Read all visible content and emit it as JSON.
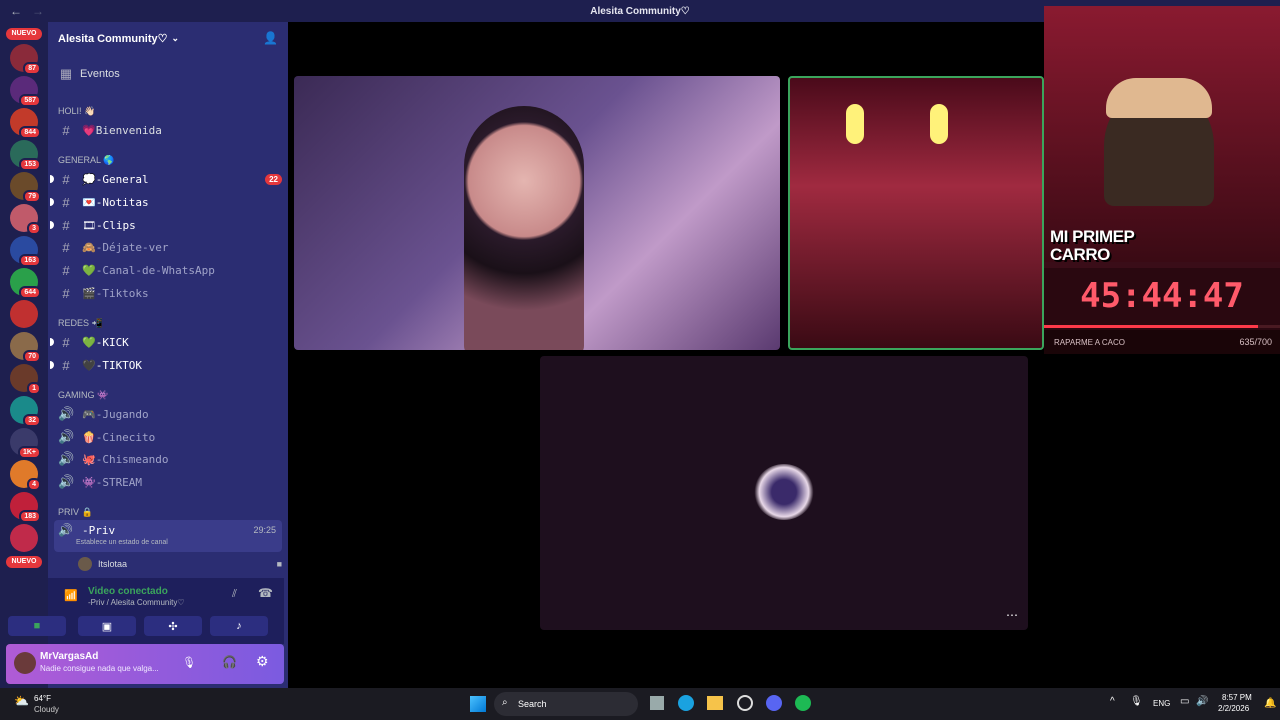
{
  "window": {
    "title": "Alesita Community♡",
    "back_icon": "arrow-left-icon",
    "forward_icon": "arrow-right-icon"
  },
  "servers": {
    "top_badge": "NUEVO",
    "bottom_badge": "NUEVO",
    "items": [
      {
        "badge": "87",
        "color": "#8a2a3a"
      },
      {
        "badge": "587",
        "color": "#5a2a7a"
      },
      {
        "badge": "844",
        "color": "#c23a2a"
      },
      {
        "badge": "153",
        "color": "#2a6a5a"
      },
      {
        "badge": "79",
        "color": "#6a4a2a"
      },
      {
        "badge": "3",
        "color": "#c05a6a"
      },
      {
        "badge": "163",
        "color": "#2a4aa0"
      },
      {
        "badge": "644",
        "color": "#2aa04a"
      },
      {
        "badge": "",
        "color": "#c03030"
      },
      {
        "badge": "70",
        "color": "#8a6a4a"
      },
      {
        "badge": "1",
        "color": "#6a3a2a"
      },
      {
        "badge": "32",
        "color": "#1a8a8a"
      },
      {
        "badge": "1K+",
        "color": "#3a3a6a"
      },
      {
        "badge": "4",
        "color": "#e07a2a"
      },
      {
        "badge": "183",
        "color": "#c0203a"
      },
      {
        "badge": "",
        "color": "#c02a4a"
      }
    ]
  },
  "guild": {
    "name": "Alesita Community♡",
    "invite_icon": "add-member-icon"
  },
  "sidebar": {
    "events": "Eventos",
    "categories": [
      {
        "label": "HOLI! 👋🏻"
      },
      {
        "label": "GENERAL 🌎"
      },
      {
        "label": "REDES 📲"
      },
      {
        "label": "GAMING 👾"
      },
      {
        "label": "PRIV 🔒"
      }
    ],
    "channels": [
      {
        "name": "💗Bienvenida"
      },
      {
        "name": "💭-General",
        "count": "22"
      },
      {
        "name": "💌-Notitas"
      },
      {
        "name": "🎞-Clips"
      },
      {
        "name": "🙈-Déjate-ver"
      },
      {
        "name": "💚-Canal-de-WhatsApp"
      },
      {
        "name": "🎬-Tiktoks"
      },
      {
        "name": "💚-KICK"
      },
      {
        "name": "🖤-TIKTOK"
      },
      {
        "name": "🎮-Jugando"
      },
      {
        "name": "🍿-Cinecito"
      },
      {
        "name": "🐙-Chismeando"
      },
      {
        "name": "👾-STREAM"
      }
    ],
    "voice_channel": {
      "name": "-Priv",
      "time": "29:25",
      "status": "Establece un estado de canal",
      "member": "Itslotaa"
    }
  },
  "voice": {
    "status": "Video conectado",
    "location": "-Priv / Alesita Community♡"
  },
  "user": {
    "name": "MrVargasAd",
    "status": "Nadie consigue nada que valga..."
  },
  "overlay": {
    "headline": "MI PRIMEP CARRO",
    "timer": "45:44:47",
    "caption": "RAPARME A CACO",
    "progress": "635/700",
    "progress_fraction": 0.907
  },
  "taskbar": {
    "weather_temp": "64°F",
    "weather_desc": "Cloudy",
    "search": "Search",
    "lang": "ENG",
    "time": "8:57 PM",
    "date": "2/2/2026"
  }
}
